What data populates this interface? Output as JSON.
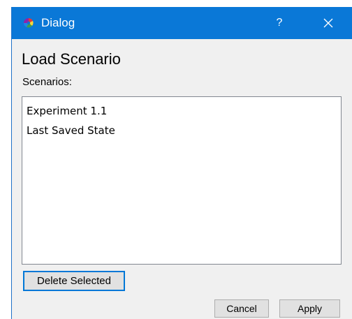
{
  "window": {
    "title": "Dialog",
    "help_label": "?",
    "close_icon": "close-icon",
    "app_icon": "app-logo-icon"
  },
  "main": {
    "heading": "Load Scenario",
    "list_label": "Scenarios:",
    "scenarios": [
      {
        "label": "Experiment 1.1"
      },
      {
        "label": "Last Saved State"
      }
    ],
    "delete_label": "Delete Selected"
  },
  "footer": {
    "cancel_label": "Cancel",
    "apply_label": "Apply"
  },
  "colors": {
    "titlebar": "#0a78d7",
    "background": "#f0f0f0",
    "focus_border": "#0078d7"
  }
}
